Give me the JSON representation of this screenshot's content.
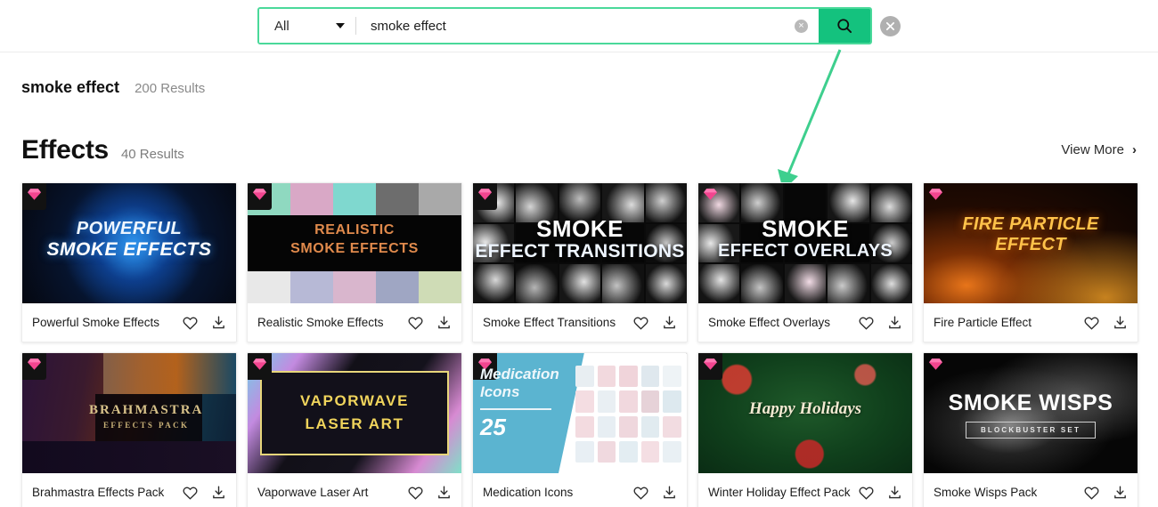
{
  "search": {
    "category_label": "All",
    "query_value": "smoke effect",
    "query_placeholder": "Search",
    "clear_glyph": "×",
    "close_glyph": "×",
    "search_icon": "search-icon"
  },
  "results": {
    "query_term": "smoke effect",
    "query_count": "200 Results",
    "section_title": "Effects",
    "section_count": "40 Results",
    "view_more_label": "View More",
    "view_more_chevron": "›"
  },
  "accent": {
    "green": "#14c27e",
    "green_border": "#4ad99a",
    "arrow": "#3ecf8e",
    "gem_pink": "#f2458f"
  },
  "cards": [
    {
      "title": "Powerful Smoke Effects",
      "badge": "premium-gem",
      "art_text_line1": "POWERFUL",
      "art_text_line2": "SMOKE EFFECTS"
    },
    {
      "title": "Realistic Smoke Effects",
      "badge": "premium-gem",
      "art_text_line1": "REALISTIC",
      "art_text_line2": "SMOKE EFFECTS"
    },
    {
      "title": "Smoke Effect Transitions",
      "badge": "premium-gem",
      "art_text_line1": "SMOKE",
      "art_text_line2": "EFFECT TRANSITIONS"
    },
    {
      "title": "Smoke Effect Overlays",
      "badge": "premium-gem",
      "art_text_line1": "SMOKE",
      "art_text_line2": "EFFECT OVERLAYS"
    },
    {
      "title": "Fire Particle Effect",
      "badge": "premium-gem",
      "art_text_line1": "FIRE PARTICLE",
      "art_text_line2": "EFFECT"
    },
    {
      "title": "Brahmastra Effects Pack",
      "badge": "premium-gem",
      "art_text_line1": "BRAHMASTRA",
      "art_text_line2": "EFFECTS PACK"
    },
    {
      "title": "Vaporwave Laser Art",
      "badge": "premium-gem",
      "art_text_line1": "VAPORWAVE",
      "art_text_line2": "LASER ART"
    },
    {
      "title": "Medication Icons",
      "badge": "premium-gem",
      "art_text_line1": "Medication Icons",
      "art_text_line2": "25"
    },
    {
      "title": "Winter Holiday Effect Pack",
      "badge": "premium-gem",
      "art_text_line1": "Happy Holidays",
      "art_text_line2": ""
    },
    {
      "title": "Smoke Wisps Pack",
      "badge": "premium-gem",
      "art_text_line1": "SMOKE WISPS",
      "art_text_line2": "BLOCKBUSTER SET"
    }
  ],
  "card_actions": {
    "favorite": "heart-icon",
    "download": "download-icon"
  }
}
